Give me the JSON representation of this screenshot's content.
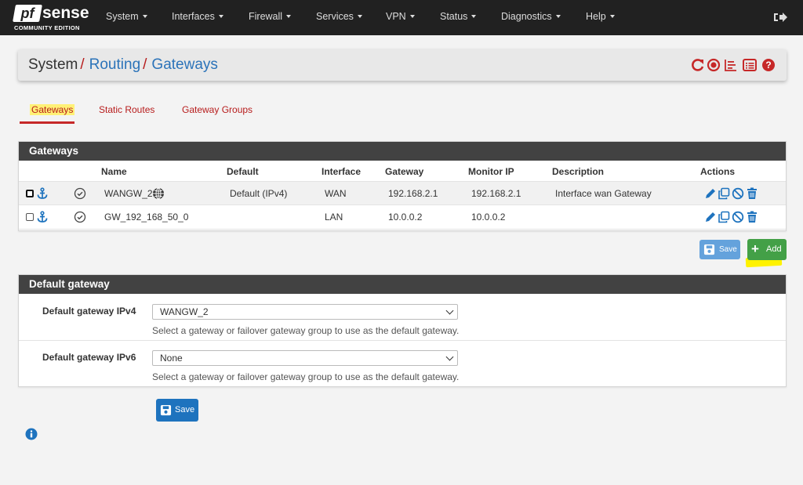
{
  "brand": {
    "logo_pf": "pf",
    "logo_sense": "sense",
    "edition": "COMMUNITY EDITION"
  },
  "nav": {
    "items": [
      "System",
      "Interfaces",
      "Firewall",
      "Services",
      "VPN",
      "Status",
      "Diagnostics",
      "Help"
    ],
    "logout_icon": "sign-out-icon"
  },
  "breadcrumb": {
    "parts": [
      "System",
      "Routing",
      "Gateways"
    ],
    "separator": "/",
    "icons": [
      "reload-icon",
      "stop-circle-icon",
      "chart-icon",
      "list-icon",
      "help-icon"
    ]
  },
  "tabs": [
    {
      "label": "Gateways",
      "active": true
    },
    {
      "label": "Static Routes",
      "active": false
    },
    {
      "label": "Gateway Groups",
      "active": false
    }
  ],
  "gateways_panel": {
    "title": "Gateways",
    "columns": [
      "Name",
      "Default",
      "Interface",
      "Gateway",
      "Monitor IP",
      "Description",
      "Actions"
    ],
    "rows": [
      {
        "name": "WANGW_2",
        "default": "Default (IPv4)",
        "interface": "WAN",
        "gateway": "192.168.2.1",
        "monitor_ip": "192.168.2.1",
        "description": "Interface wan Gateway"
      },
      {
        "name": "GW_192_168_50_0",
        "default": "",
        "interface": "LAN",
        "gateway": "10.0.0.2",
        "monitor_ip": "10.0.0.2",
        "description": ""
      }
    ],
    "save_label": "Save",
    "add_label": "Add"
  },
  "default_gateway_panel": {
    "title": "Default gateway",
    "ipv4_label": "Default gateway IPv4",
    "ipv4_value": "WANGW_2",
    "ipv6_label": "Default gateway IPv6",
    "ipv6_value": "None",
    "help_text": "Select a gateway or failover gateway group to use as the default gateway.",
    "save_label": "Save"
  },
  "colors": {
    "navbar": "#212121",
    "link_blue": "#2b73b9",
    "tab_red": "#b71c1c",
    "panel_header": "#424242",
    "add_green": "#43a047",
    "save_blue": "#1e73be",
    "highlight_yellow": "#fff200"
  }
}
